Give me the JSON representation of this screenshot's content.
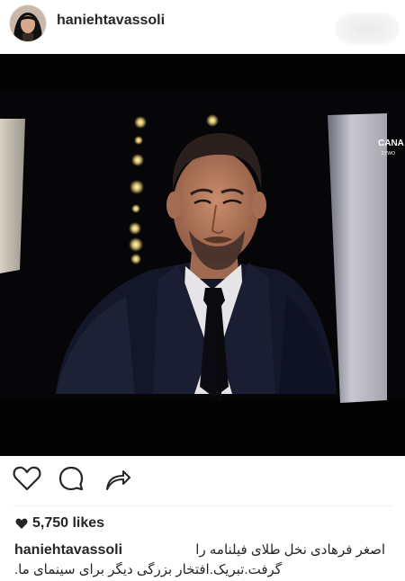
{
  "header": {
    "username": "haniehtavassoli"
  },
  "photo": {
    "broadcast_logo": "CANA",
    "broadcast_sub": "ΣΥWO"
  },
  "actions": {
    "like_icon": "heart-outline-icon",
    "comment_icon": "comment-bubble-icon",
    "share_icon": "share-arrow-icon"
  },
  "likes": {
    "icon": "heart-filled-icon",
    "text": "5,750 likes"
  },
  "caption": {
    "username": "haniehtavassoli",
    "line1": "اصغر فرهادی نخل طلای فیلنامه را",
    "line2": ".گرفت.تبریک.افتخار بزرگی دیگر برای سینمای ما"
  },
  "colors": {
    "text": "#262626",
    "photo_background": "#030303",
    "suit": "#14172a",
    "skin": "#b47a5e"
  }
}
